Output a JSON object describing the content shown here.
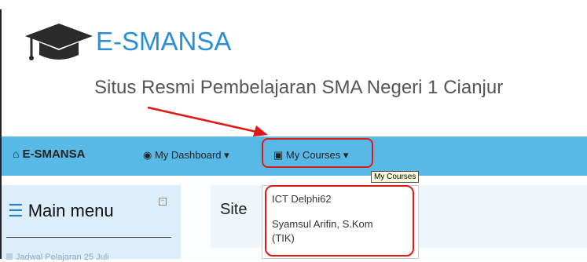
{
  "header": {
    "brand": "E-SMANSA",
    "tagline": "Situs Resmi Pembelajaran SMA Negeri 1 Cianjur"
  },
  "navbar": {
    "home_icon": "home-icon",
    "brand": "E-SMANSA",
    "dashboard_label": "My Dashboard",
    "courses_label": "My Courses",
    "color": "#58b8e6"
  },
  "tooltip": {
    "text": "My Courses"
  },
  "dropdown": {
    "items": [
      {
        "label": "ICT Delphi62"
      },
      {
        "label": "Syamsul Arifin, S.Kom (TIK)"
      }
    ]
  },
  "sidebar": {
    "title": "Main menu",
    "items": [
      {
        "label": "Jadwal Pelajaran 25 Juli"
      }
    ]
  },
  "main": {
    "title": "Site"
  },
  "annotations": {
    "highlight_color": "#e01818"
  }
}
